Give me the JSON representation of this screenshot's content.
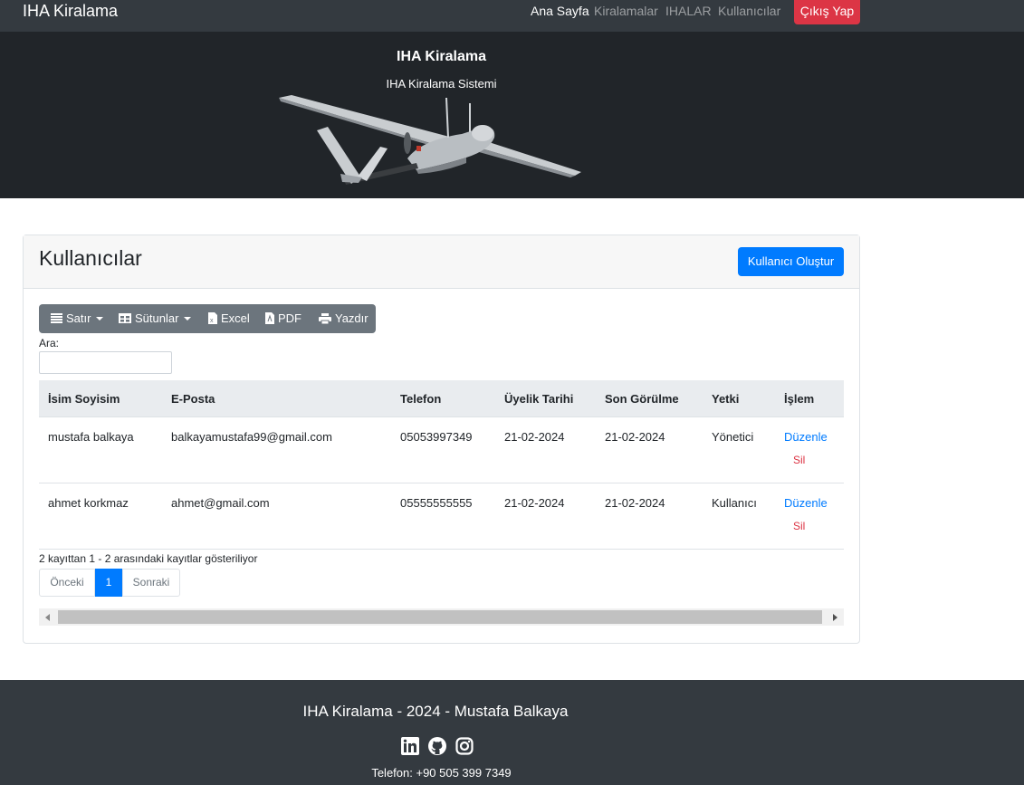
{
  "navbar": {
    "brand": "IHA Kiralama",
    "links": [
      "Ana Sayfa",
      "Kiralamalar",
      "IHALAR",
      "Kullanıcılar"
    ],
    "logout": "Çıkış Yap"
  },
  "hero": {
    "title": "IHA Kiralama",
    "subtitle": "IHA Kiralama Sistemi"
  },
  "card": {
    "title": "Kullanıcılar",
    "create_button": "Kullanıcı Oluştur",
    "toolbar": {
      "rows": "Satır",
      "columns": "Sütunlar",
      "excel": "Excel",
      "pdf": "PDF",
      "print": "Yazdır"
    },
    "search_label": "Ara:",
    "search_value": "",
    "table": {
      "headers": [
        "İsim Soyisim",
        "E-Posta",
        "Telefon",
        "Üyelik Tarihi",
        "Son Görülme",
        "Yetki",
        "İşlem"
      ],
      "rows": [
        {
          "name": "mustafa balkaya",
          "email": "balkayamustafa99@gmail.com",
          "phone": "05053997349",
          "member_since": "21-02-2024",
          "last_seen": "21-02-2024",
          "role": "Yönetici",
          "edit": "Düzenle",
          "delete": "Sil"
        },
        {
          "name": "ahmet korkmaz",
          "email": "ahmet@gmail.com",
          "phone": "05555555555",
          "member_since": "21-02-2024",
          "last_seen": "21-02-2024",
          "role": "Kullanıcı",
          "edit": "Düzenle",
          "delete": "Sil"
        }
      ]
    },
    "info": "2 kayıttan 1 - 2 arasındaki kayıtlar gösteriliyor",
    "pagination": {
      "prev": "Önceki",
      "current": "1",
      "next": "Sonraki"
    }
  },
  "footer": {
    "text": "IHA Kiralama - 2024 - Mustafa Balkaya",
    "social_icons": [
      "linkedin-icon",
      "github-icon",
      "instagram-icon"
    ],
    "phone": "Telefon: +90 505 399 7349"
  },
  "colors": {
    "navbar_bg": "#343a40",
    "hero_bg": "#212529",
    "primary": "#007bff",
    "danger": "#dc3545",
    "toolbar_bg": "#6c757d"
  }
}
